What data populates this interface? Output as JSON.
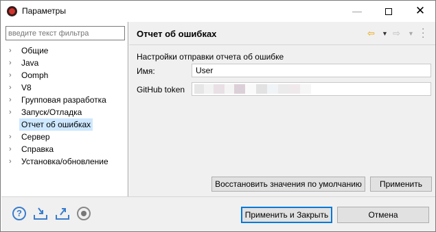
{
  "window": {
    "title": "Параметры"
  },
  "filter": {
    "placeholder": "введите текст фильтра"
  },
  "tree": {
    "items": [
      {
        "label": "Общие",
        "has_children": true
      },
      {
        "label": "Java",
        "has_children": true
      },
      {
        "label": "Oomph",
        "has_children": true
      },
      {
        "label": "V8",
        "has_children": true
      },
      {
        "label": "Групповая разработка",
        "has_children": true
      },
      {
        "label": "Запуск/Отладка",
        "has_children": true
      },
      {
        "label": "Отчет  об ошибках",
        "has_children": false,
        "selected": true
      },
      {
        "label": "Сервер",
        "has_children": true
      },
      {
        "label": "Справка",
        "has_children": true
      },
      {
        "label": "Установка/обновление",
        "has_children": true
      }
    ]
  },
  "page": {
    "title": "Отчет  об ошибках",
    "description": "Настройки отправки отчета об ошибке",
    "name_label": "Имя:",
    "name_value": "User",
    "token_label": "GitHub token"
  },
  "buttons": {
    "restore": "Восстановить значения по умолчанию",
    "apply": "Применить",
    "apply_close": "Применить и Закрыть",
    "cancel": "Отмена"
  },
  "icons": {
    "help": "help-icon",
    "import": "import-icon",
    "export": "export-icon",
    "record": "record-icon"
  },
  "colors": {
    "selection": "#cde8ff",
    "accent_border": "#0078d7",
    "back_arrow": "#e9a200"
  }
}
